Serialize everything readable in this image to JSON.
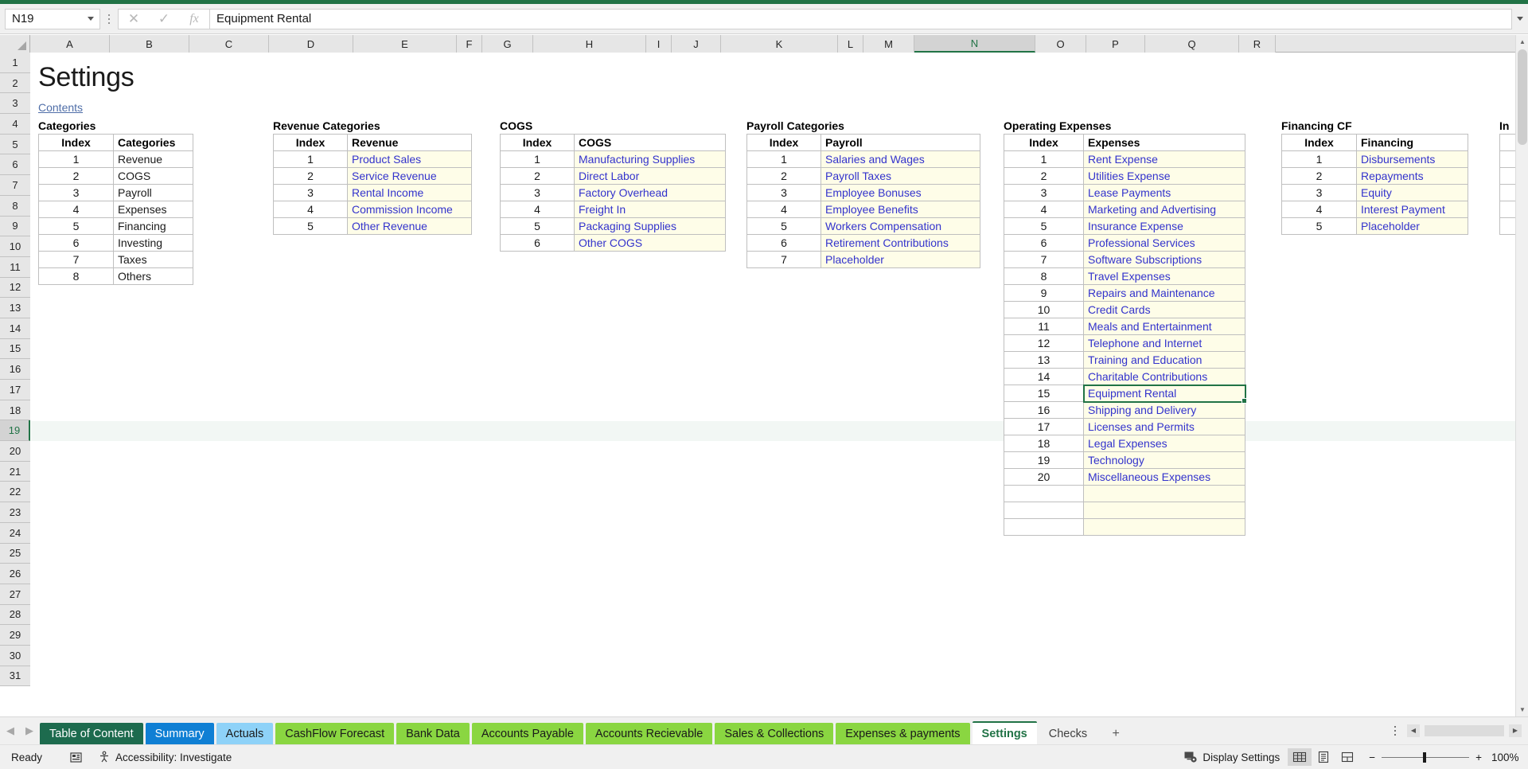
{
  "app": {
    "name_box_value": "N19",
    "formula_value": "Equipment Rental",
    "cancel_icon": "close-icon",
    "confirm_icon": "check-icon",
    "function_icon": "fx-icon"
  },
  "grid": {
    "columns": [
      "A",
      "B",
      "C",
      "D",
      "E",
      "F",
      "G",
      "H",
      "I",
      "J",
      "K",
      "L",
      "M",
      "N",
      "O",
      "P",
      "Q",
      "R"
    ],
    "selected_column": "N",
    "rows": [
      1,
      2,
      3,
      4,
      5,
      6,
      7,
      8,
      9,
      10,
      11,
      12,
      13,
      14,
      15,
      16,
      17,
      18,
      19,
      20,
      21,
      22,
      23,
      24,
      25,
      26,
      27,
      28,
      29,
      30,
      31
    ],
    "selected_row": 19
  },
  "sheet": {
    "title": "Settings",
    "contents_link": "Contents"
  },
  "tables": {
    "categories": {
      "title": "Categories",
      "headers": [
        "Index",
        "Categories"
      ],
      "rows": [
        [
          "1",
          "Revenue"
        ],
        [
          "2",
          "COGS"
        ],
        [
          "3",
          "Payroll"
        ],
        [
          "4",
          "Expenses"
        ],
        [
          "5",
          "Financing"
        ],
        [
          "6",
          "Investing"
        ],
        [
          "7",
          "Taxes"
        ],
        [
          "8",
          "Others"
        ]
      ]
    },
    "revenue": {
      "title": "Revenue Categories",
      "headers": [
        "Index",
        "Revenue"
      ],
      "rows": [
        [
          "1",
          "Product Sales"
        ],
        [
          "2",
          "Service Revenue"
        ],
        [
          "3",
          "Rental Income"
        ],
        [
          "4",
          "Commission Income"
        ],
        [
          "5",
          "Other Revenue"
        ]
      ]
    },
    "cogs": {
      "title": "COGS",
      "headers": [
        "Index",
        "COGS"
      ],
      "rows": [
        [
          "1",
          "Manufacturing Supplies"
        ],
        [
          "2",
          "Direct Labor"
        ],
        [
          "3",
          "Factory Overhead"
        ],
        [
          "4",
          "Freight In"
        ],
        [
          "5",
          "Packaging Supplies"
        ],
        [
          "6",
          "Other COGS"
        ]
      ]
    },
    "payroll": {
      "title": "Payroll Categories",
      "headers": [
        "Index",
        "Payroll"
      ],
      "rows": [
        [
          "1",
          "Salaries and Wages"
        ],
        [
          "2",
          "Payroll Taxes"
        ],
        [
          "3",
          "Employee Bonuses"
        ],
        [
          "4",
          "Employee Benefits"
        ],
        [
          "5",
          "Workers Compensation"
        ],
        [
          "6",
          "Retirement Contributions"
        ],
        [
          "7",
          "Placeholder"
        ]
      ]
    },
    "expenses": {
      "title": "Operating Expenses",
      "headers": [
        "Index",
        "Expenses"
      ],
      "rows": [
        [
          "1",
          "Rent Expense"
        ],
        [
          "2",
          "Utilities Expense"
        ],
        [
          "3",
          "Lease Payments"
        ],
        [
          "4",
          "Marketing and Advertising"
        ],
        [
          "5",
          "Insurance Expense"
        ],
        [
          "6",
          "Professional Services"
        ],
        [
          "7",
          "Software Subscriptions"
        ],
        [
          "8",
          "Travel Expenses"
        ],
        [
          "9",
          "Repairs and Maintenance"
        ],
        [
          "10",
          "Credit Cards"
        ],
        [
          "11",
          "Meals and Entertainment"
        ],
        [
          "12",
          "Telephone and Internet"
        ],
        [
          "13",
          "Training and Education"
        ],
        [
          "14",
          "Charitable Contributions"
        ],
        [
          "15",
          "Equipment Rental"
        ],
        [
          "16",
          "Shipping and Delivery"
        ],
        [
          "17",
          "Licenses and Permits"
        ],
        [
          "18",
          "Legal Expenses"
        ],
        [
          "19",
          "Technology"
        ],
        [
          "20",
          "Miscellaneous Expenses"
        ],
        [
          "",
          ""
        ],
        [
          "",
          ""
        ],
        [
          "",
          ""
        ]
      ],
      "active_row_index": 14
    },
    "financing": {
      "title": "Financing CF",
      "headers": [
        "Index",
        "Financing"
      ],
      "rows": [
        [
          "1",
          "Disbursements"
        ],
        [
          "2",
          "Repayments"
        ],
        [
          "3",
          "Equity"
        ],
        [
          "4",
          "Interest Payment"
        ],
        [
          "5",
          "Placeholder"
        ]
      ]
    },
    "investing_partial": {
      "title": "In",
      "rows": [
        "",
        "",
        "",
        "",
        "",
        ""
      ]
    }
  },
  "tabs": {
    "items": [
      {
        "label": "Table of Content",
        "color": "#1d6b4e",
        "text_color": "#ffffff",
        "active": false
      },
      {
        "label": "Summary",
        "color": "#0f7fd4",
        "text_color": "#ffffff",
        "active": false
      },
      {
        "label": "Actuals",
        "color": "#8ed2f8",
        "text_color": "#1a1a1a",
        "active": false
      },
      {
        "label": "CashFlow Forecast",
        "color": "#8ad641",
        "text_color": "#1a1a1a",
        "active": false
      },
      {
        "label": "Bank Data",
        "color": "#8ad641",
        "text_color": "#1a1a1a",
        "active": false
      },
      {
        "label": "Accounts Payable",
        "color": "#8ad641",
        "text_color": "#1a1a1a",
        "active": false
      },
      {
        "label": "Accounts Recievable",
        "color": "#8ad641",
        "text_color": "#1a1a1a",
        "active": false
      },
      {
        "label": "Sales & Collections",
        "color": "#8ad641",
        "text_color": "#1a1a1a",
        "active": false
      },
      {
        "label": "Expenses & payments",
        "color": "#8ad641",
        "text_color": "#1a1a1a",
        "active": false
      },
      {
        "label": "Settings",
        "color": "#ffffff",
        "text_color": "#217346",
        "active": true
      },
      {
        "label": "Checks",
        "color": "#f0f0f0",
        "text_color": "#404040",
        "active": false
      }
    ],
    "add_sheet_label": "+",
    "nav_prev": "◀",
    "nav_next": "▶"
  },
  "status": {
    "ready": "Ready",
    "accessibility": "Accessibility: Investigate",
    "display_settings": "Display Settings",
    "zoom": "100%",
    "zoom_minus": "−",
    "zoom_plus": "+"
  }
}
